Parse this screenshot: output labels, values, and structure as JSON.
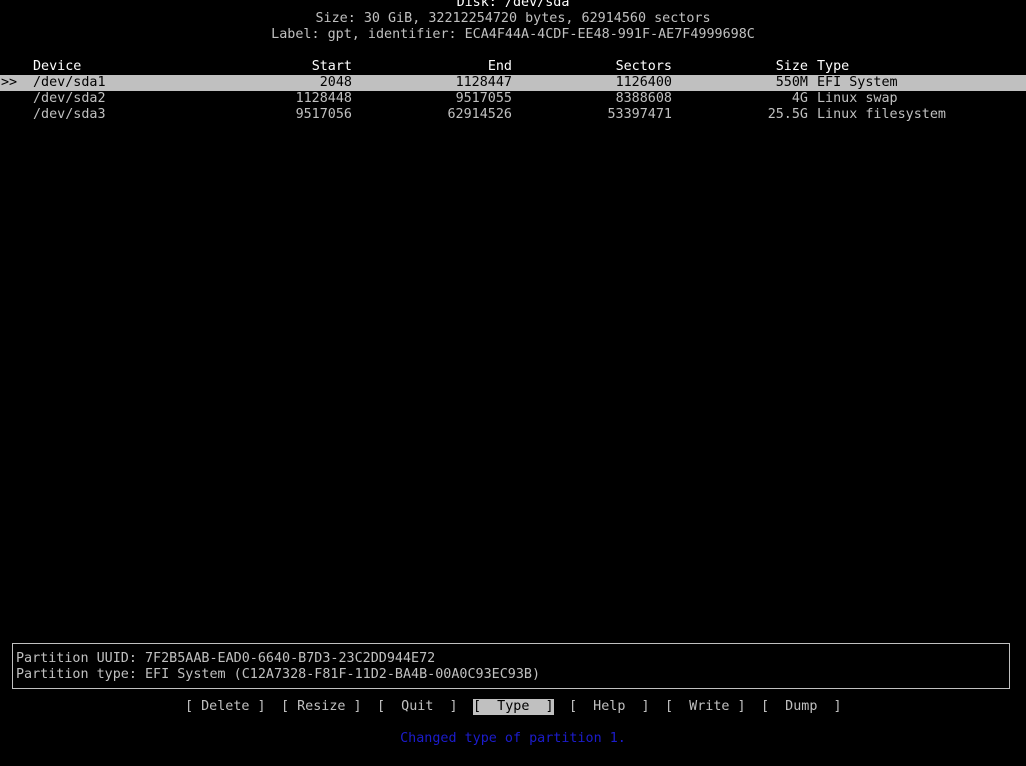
{
  "header": {
    "disk_title": "Disk: /dev/sda",
    "size_line": "Size: 30 GiB, 32212254720 bytes, 62914560 sectors",
    "label_line": "Label: gpt, identifier: ECA4F44A-4CDF-EE48-991F-AE7F4999698C"
  },
  "table": {
    "columns": {
      "device": "Device",
      "start": "Start",
      "end": "End",
      "sectors": "Sectors",
      "size": "Size",
      "type": "Type"
    },
    "cursor": ">>",
    "rows": [
      {
        "device": "/dev/sda1",
        "start": "2048",
        "end": "1128447",
        "sectors": "1126400",
        "size": "550M",
        "type": "EFI System"
      },
      {
        "device": "/dev/sda2",
        "start": "1128448",
        "end": "9517055",
        "sectors": "8388608",
        "size": "4G",
        "type": "Linux swap"
      },
      {
        "device": "/dev/sda3",
        "start": "9517056",
        "end": "62914526",
        "sectors": "53397471",
        "size": "25.5G",
        "type": "Linux filesystem"
      }
    ]
  },
  "info": {
    "uuid_line": "Partition UUID: 7F2B5AAB-EAD0-6640-B7D3-23C2DD944E72",
    "type_line": "Partition type: EFI System (C12A7328-F81F-11D2-BA4B-00A0C93EC93B)"
  },
  "menu": {
    "delete": "[ Delete ]",
    "resize": "[ Resize ]",
    "quit": "[  Quit  ]",
    "type": "[  Type  ]",
    "help": "[  Help  ]",
    "write": "[  Write ]",
    "dump": "[  Dump  ]"
  },
  "status_message": "Changed type of partition 1.",
  "colors": {
    "background": "#000000",
    "text": "#c0c0c0",
    "highlight": "#c0c0c0",
    "status": "#1c1ccc"
  }
}
